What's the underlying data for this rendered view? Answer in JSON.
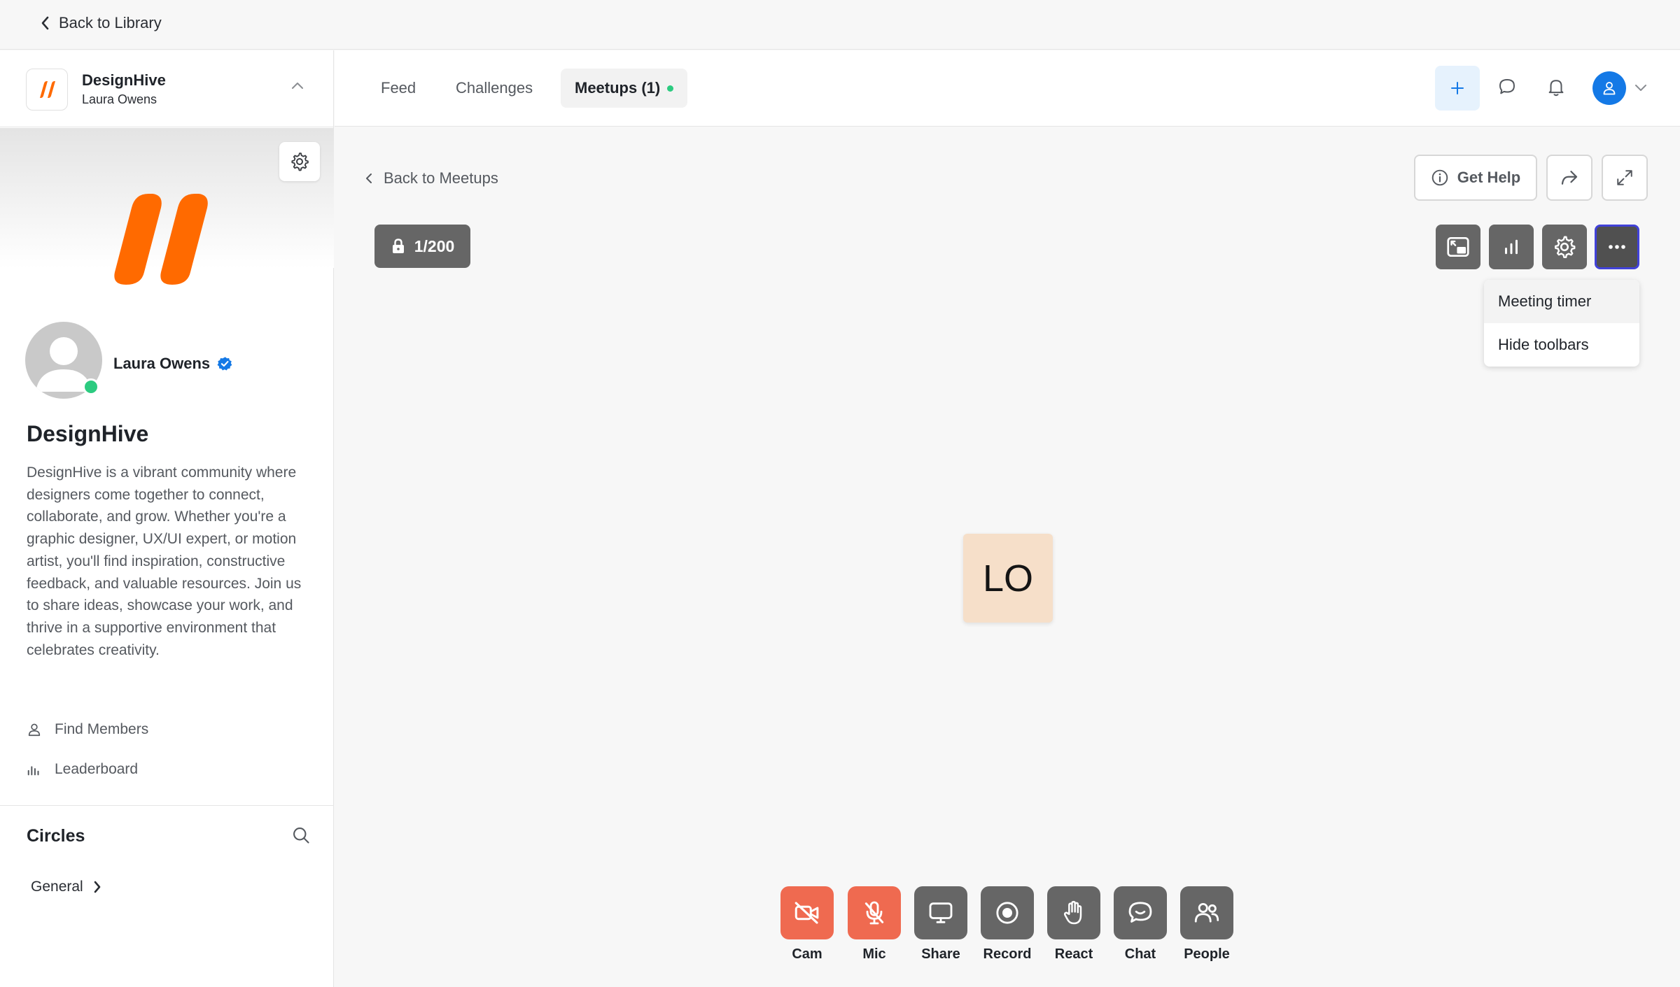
{
  "topbar": {
    "back_label": "Back to Library"
  },
  "community": {
    "name": "DesignHive",
    "owner": "Laura Owens"
  },
  "profile": {
    "name": "Laura Owens",
    "status": "online"
  },
  "about": {
    "title": "DesignHive",
    "description": "DesignHive is a vibrant community where designers come together to connect, collaborate, and grow. Whether you're a graphic designer, UX/UI expert, or motion artist, you'll find inspiration, constructive feedback, and valuable resources. Join us to share ideas, showcase your work, and thrive in a supportive environment that celebrates creativity."
  },
  "sidebar_links": [
    {
      "label": "Find Members",
      "icon": "user-icon"
    },
    {
      "label": "Leaderboard",
      "icon": "bar-chart-icon"
    }
  ],
  "circles": {
    "title": "Circles",
    "items": [
      {
        "label": "General"
      }
    ]
  },
  "nav": {
    "tabs": [
      {
        "label": "Feed"
      },
      {
        "label": "Challenges"
      },
      {
        "label": "Meetups (1)",
        "active": true
      }
    ]
  },
  "meetup": {
    "back_label": "Back to Meetups",
    "get_help": "Get Help",
    "capacity": "1/200",
    "menu": [
      {
        "label": "Meeting timer"
      },
      {
        "label": "Hide toolbars"
      }
    ],
    "participant_initials": "LO"
  },
  "controls": [
    {
      "label": "Cam",
      "icon": "camera-off-icon",
      "state": "off"
    },
    {
      "label": "Mic",
      "icon": "mic-off-icon",
      "state": "off"
    },
    {
      "label": "Share",
      "icon": "screen-share-icon"
    },
    {
      "label": "Record",
      "icon": "record-icon"
    },
    {
      "label": "React",
      "icon": "hand-icon"
    },
    {
      "label": "Chat",
      "icon": "chat-icon"
    },
    {
      "label": "People",
      "icon": "people-icon"
    }
  ],
  "colors": {
    "brand_orange": "#ff6a00",
    "accent_blue": "#1479e6",
    "online_green": "#2ccb80",
    "control_off_red": "#ef6a50",
    "control_gray": "#666666",
    "tile_bg": "#f6dfc9"
  }
}
